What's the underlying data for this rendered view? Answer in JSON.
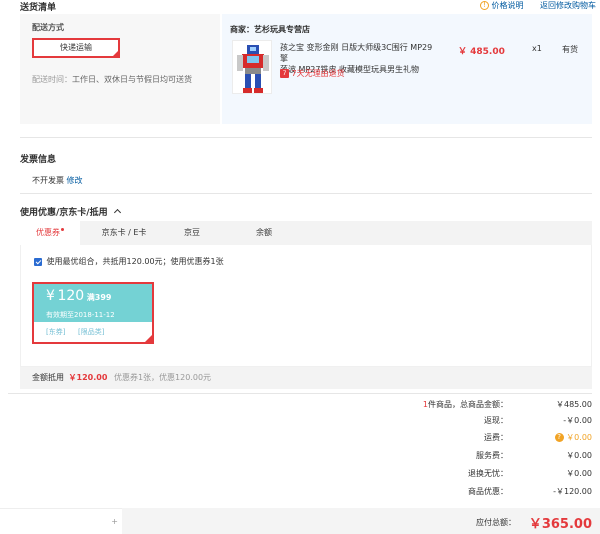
{
  "delivery": {
    "title": "送货清单",
    "price_note": "价格说明",
    "back_to_cart": "返回修改购物车",
    "method_label": "配送方式",
    "method_value": "快递运输",
    "time_label": "配送时间：",
    "time_value": "工作日、双休日与节假日均可送货",
    "shop_label": "商家：",
    "shop_name": "艺杉玩具专营店",
    "product": {
      "title_line1": "孩之宝 变形金刚 日版大师级3C围行 MP29擎",
      "title_line2": "落波 MP27铁皮 收藏模型玩具男生礼物",
      "price": "￥ 485.00",
      "qty": "x1",
      "stock": "有货",
      "return_policy": "7天无理由退货"
    }
  },
  "invoice": {
    "title": "发票信息",
    "value": "不开发票",
    "edit": "修改"
  },
  "coupons": {
    "title": "使用优惠/京东卡/抵用",
    "tabs": [
      {
        "label": "优惠券"
      },
      {
        "label": "京东卡 / E卡"
      },
      {
        "label": "京豆"
      },
      {
        "label": "余额"
      }
    ],
    "best_combo_text": "使用最优组合，共抵用120.00元；使用优惠券1张",
    "coupon": {
      "currency": "¥",
      "amount": "120",
      "condition": "满399",
      "expiry": "有效期至2018-11-12",
      "tag1": "[东券]",
      "tag2": "[限品类]"
    },
    "amount_label": "金额抵用",
    "amount_value": "￥120.00",
    "amount_detail": "优惠券1张，优惠120.00元"
  },
  "summary": {
    "count": "1",
    "count_text": "件商品，总商品金额：",
    "total_goods": "￥485.00",
    "rebate_label": "返现：",
    "rebate_value": "-￥0.00",
    "shipping_label": "运费：",
    "shipping_value": "￥0.00",
    "service_label": "服务费：",
    "service_value": "￥0.00",
    "return_label": "退换无忧：",
    "return_value": "￥0.00",
    "discount_label": "商品优惠：",
    "discount_value": "-￥120.00",
    "payable_label": "应付总额：",
    "payable_value": "￥365.00"
  },
  "icons": {
    "info": "info-circle-icon",
    "warn": "warning-circle-icon",
    "return": "seven-day-return-icon",
    "chevron": "chevron-up-icon"
  },
  "colors": {
    "accent_red": "#e4393c",
    "link_blue": "#005aa0",
    "coupon_teal": "#74d2d4",
    "warn_orange": "#f1a325"
  }
}
